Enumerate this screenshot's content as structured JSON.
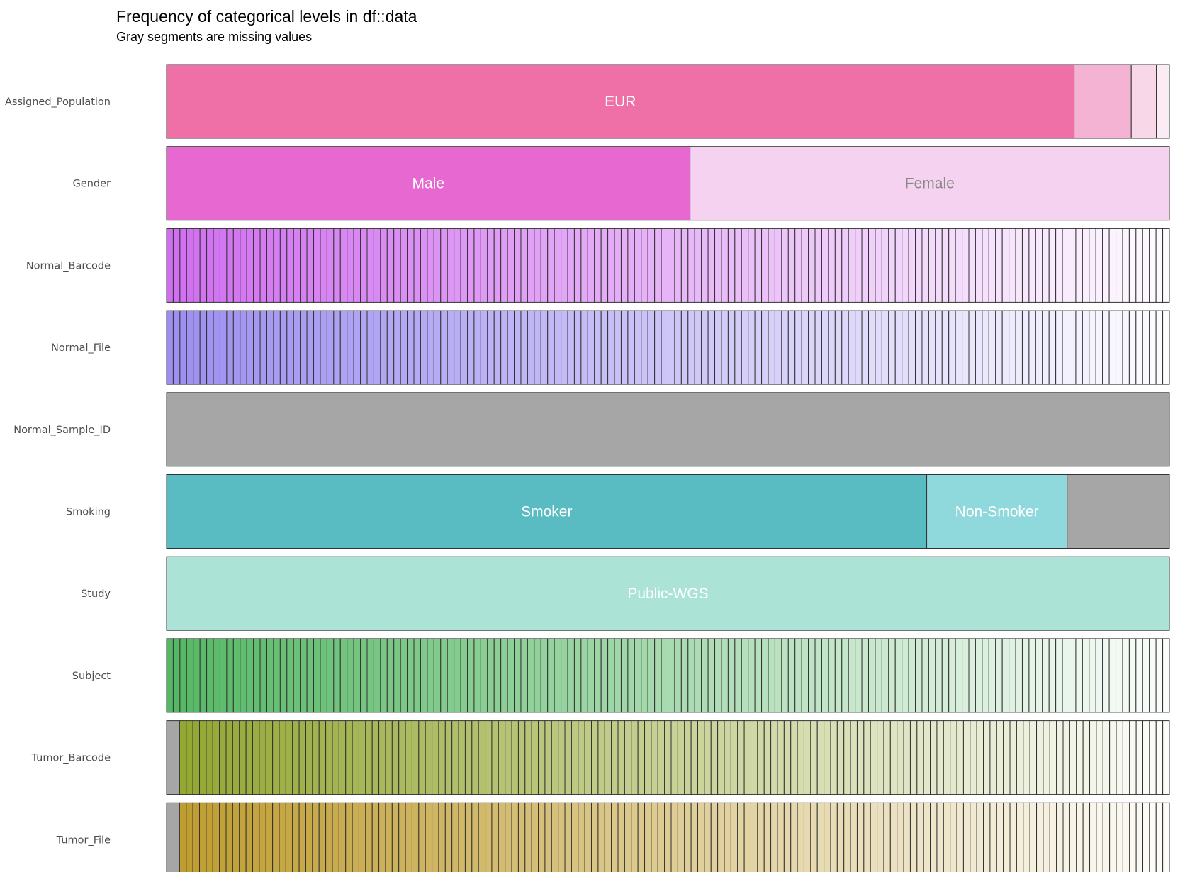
{
  "title": "Frequency of categorical levels in df::data",
  "subtitle": "Gray segments are missing values",
  "colors": {
    "missing": "#a6a6a6",
    "outline": "#333333",
    "label_light": "#ffffff",
    "label_dark": "#8a8a8a"
  },
  "chart_data": {
    "type": "bar",
    "orientation": "horizontal",
    "stacked": true,
    "scale": "proportion",
    "xlim": [
      0,
      1
    ],
    "axes_visible": false,
    "grid": false,
    "legend": "none",
    "categories": [
      "Assigned_Population",
      "Gender",
      "Normal_Barcode",
      "Normal_File",
      "Normal_Sample_ID",
      "Smoking",
      "Study",
      "Subject",
      "Tumor_Barcode",
      "Tumor_File"
    ],
    "rows": [
      {
        "variable": "Assigned_Population",
        "segments": [
          {
            "label": "EUR",
            "proportion": 0.905,
            "color": "#ef70a6",
            "text_color": "#ffffff"
          },
          {
            "label": "",
            "proportion": 0.057,
            "color": "#f4b3d2"
          },
          {
            "label": "",
            "proportion": 0.025,
            "color": "#f8d8e8"
          },
          {
            "label": "",
            "proportion": 0.013,
            "color": "#fbebf3"
          }
        ]
      },
      {
        "variable": "Gender",
        "segments": [
          {
            "label": "Male",
            "proportion": 0.522,
            "color": "#e868d2",
            "text_color": "#ffffff"
          },
          {
            "label": "Female",
            "proportion": 0.478,
            "color": "#f5d3f0",
            "text_color": "#8a8a8a"
          }
        ]
      },
      {
        "variable": "Normal_Barcode",
        "gradient": {
          "levels": 150,
          "from": "#d06ef0",
          "to": "#ffffff",
          "missing_proportion": 0
        }
      },
      {
        "variable": "Normal_File",
        "gradient": {
          "levels": 150,
          "from": "#9d8ff0",
          "to": "#ffffff",
          "missing_proportion": 0
        }
      },
      {
        "variable": "Normal_Sample_ID",
        "segments": [
          {
            "label": "",
            "proportion": 1.0,
            "color": "#a6a6a6",
            "missing": true
          }
        ]
      },
      {
        "variable": "Smoking",
        "segments": [
          {
            "label": "Smoker",
            "proportion": 0.758,
            "color": "#58bcc2",
            "text_color": "#ffffff"
          },
          {
            "label": "Non-Smoker",
            "proportion": 0.14,
            "color": "#8fd8dc",
            "text_color": "#ffffff"
          },
          {
            "label": "",
            "proportion": 0.102,
            "color": "#a6a6a6",
            "missing": true
          }
        ]
      },
      {
        "variable": "Study",
        "segments": [
          {
            "label": "Public-WGS",
            "proportion": 1.0,
            "color": "#abe4d6",
            "text_color": "#ffffff"
          }
        ]
      },
      {
        "variable": "Subject",
        "gradient": {
          "levels": 150,
          "from": "#55b864",
          "to": "#ffffff",
          "missing_proportion": 0
        }
      },
      {
        "variable": "Tumor_Barcode",
        "gradient": {
          "levels": 149,
          "from": "#93a733",
          "to": "#ffffff",
          "missing_proportion": 0.013
        }
      },
      {
        "variable": "Tumor_File",
        "gradient": {
          "levels": 149,
          "from": "#bf9d30",
          "to": "#ffffff",
          "missing_proportion": 0.013
        }
      }
    ]
  }
}
